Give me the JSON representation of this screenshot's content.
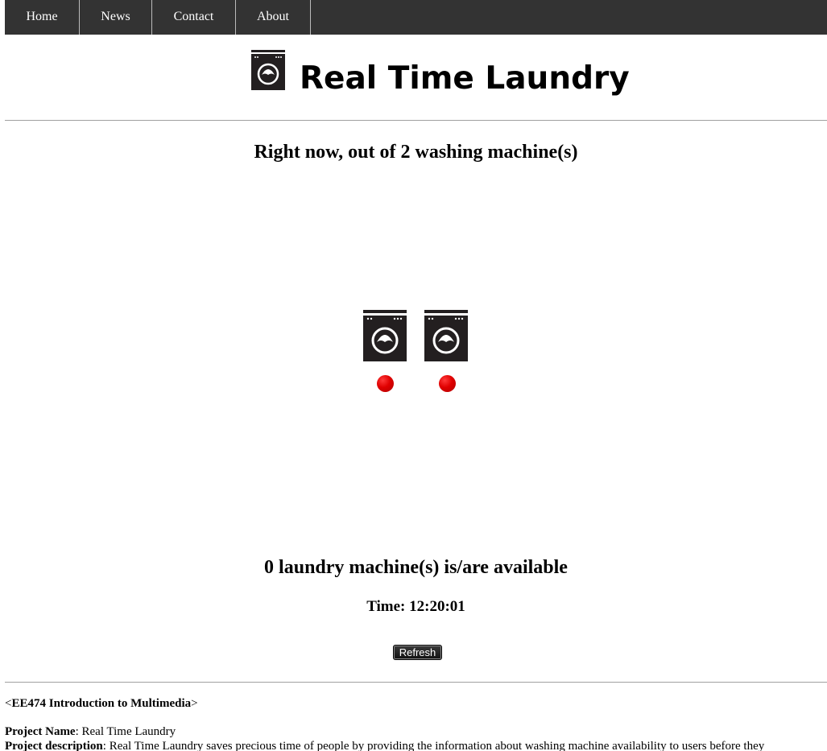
{
  "nav": {
    "items": [
      {
        "label": "Home"
      },
      {
        "label": "News"
      },
      {
        "label": "Contact"
      },
      {
        "label": "About"
      }
    ]
  },
  "header": {
    "logo_icon": "washing-machine-icon",
    "title": "Real Time Laundry"
  },
  "status": {
    "headline": "Right now, out of 2 washing machine(s)",
    "machine_count": 2,
    "machines": [
      {
        "icon": "washing-machine-icon",
        "status": "occupied",
        "status_color": "#e00000"
      },
      {
        "icon": "washing-machine-icon",
        "status": "occupied",
        "status_color": "#e00000"
      }
    ],
    "availability_text": "0 laundry machine(s) is/are available",
    "time_label": "Time:",
    "time_value": "12:20:01",
    "refresh_label": "Refresh"
  },
  "footer": {
    "course_open": "<",
    "course_name": "EE474 Introduction to Multimedia",
    "course_close": ">",
    "project_name_label": "Project Name",
    "project_name_value": ": Real Time Laundry",
    "project_desc_label": "Project description",
    "project_desc_value": ": Real Time Laundry saves precious time of people by providing the information about washing machine availability to users before they"
  },
  "colors": {
    "navbar_bg": "#333333",
    "nav_text": "#ffffff",
    "status_occupied": "#e00000",
    "icon_fill": "#231f20"
  }
}
